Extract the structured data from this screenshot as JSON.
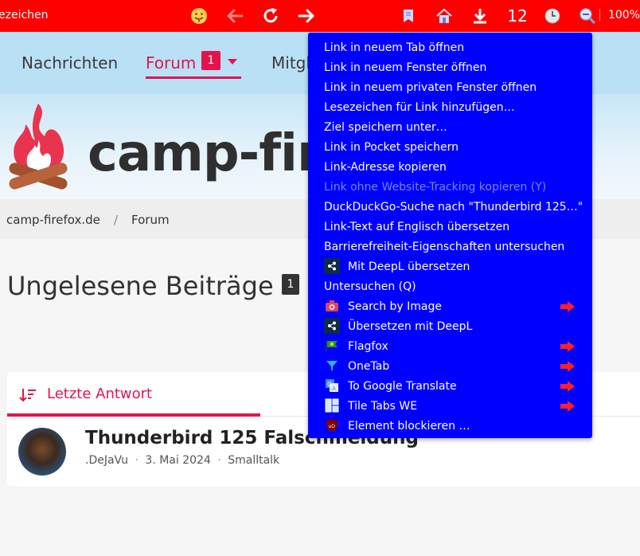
{
  "toolbar": {
    "tab_text": "ezeichen",
    "counter": "12",
    "zoom": "100%",
    "icons": [
      "emoji-icon",
      "back-arrow-icon",
      "reload-icon",
      "forward-arrow-icon",
      "reader-icon",
      "home-icon",
      "download-icon",
      "history-icon",
      "zoom-icon"
    ]
  },
  "nav": {
    "items": [
      "Nachrichten",
      "Forum",
      "Mitgl"
    ],
    "forum_badge": "1"
  },
  "banner": {
    "logo_text": "camp-fir"
  },
  "breadcrumb": {
    "home": "camp-firefox.de",
    "separator": "/",
    "current": "Forum"
  },
  "page": {
    "title": "Ungelesene Beiträge",
    "title_badge": "1"
  },
  "card": {
    "tab_label": "Letzte Antwort",
    "thread_title": "Thunderbird 125 Falschmeldung",
    "author": ".DeJaVu",
    "date": "3. Mai 2024",
    "forum": "Smalltalk",
    "meta_sep": "·"
  },
  "menu": {
    "items": [
      "Link in neuem Tab öffnen",
      "Link in neuem Fenster öffnen",
      "Link in neuem privaten Fenster öffnen",
      "Lesezeichen für Link hinzufügen…",
      "Ziel speichern unter…",
      "Link in Pocket speichern",
      "Link-Adresse kopieren",
      "Link ohne Website-Tracking kopieren (Y)",
      "DuckDuckGo-Suche nach \"Thunderbird 125…\"",
      "Link-Text auf Englisch übersetzen",
      "Barrierefreiheit-Eigenschaften untersuchen",
      "Mit DeepL übersetzen",
      "Untersuchen (Q)",
      "Search by Image",
      "Übersetzen mit DeepL",
      "Flagfox",
      "OneTab",
      "To Google Translate",
      "Tile Tabs WE",
      "Element blockieren …"
    ]
  },
  "colors": {
    "toolbar": "#ff0000",
    "menu": "#0000ff",
    "accent": "#e3144d",
    "nav": "#b9e0f5"
  }
}
